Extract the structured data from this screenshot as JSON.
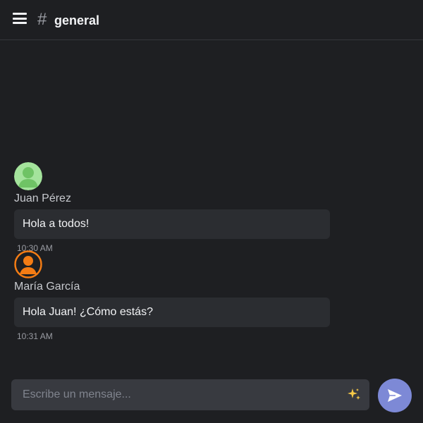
{
  "header": {
    "menu_icon": "hamburger-menu-icon",
    "hash_symbol": "#",
    "channel_name": "general"
  },
  "messages": [
    {
      "author": "Juan Pérez",
      "text": "Hola a todos!",
      "time": "10:30 AM",
      "avatar_icon": "user-avatar-icon",
      "avatar_color": "#7ccf73",
      "avatar_bg": "#a4e39c"
    },
    {
      "author": "María García",
      "text": "Hola Juan! ¿Cómo estás?",
      "time": "10:31 AM",
      "avatar_icon": "user-avatar-icon",
      "avatar_color": "#f47c14",
      "avatar_bg": "#1e1f22"
    }
  ],
  "composer": {
    "placeholder": "Escribe un mensaje...",
    "value": "",
    "emoji_icon": "sparkles-icon",
    "send_icon": "send-icon",
    "send_color": "#7d89d6"
  },
  "colors": {
    "background": "#1e1f22",
    "bubble": "#2b2d31",
    "input": "#383a40",
    "accent": "#7d89d6"
  }
}
